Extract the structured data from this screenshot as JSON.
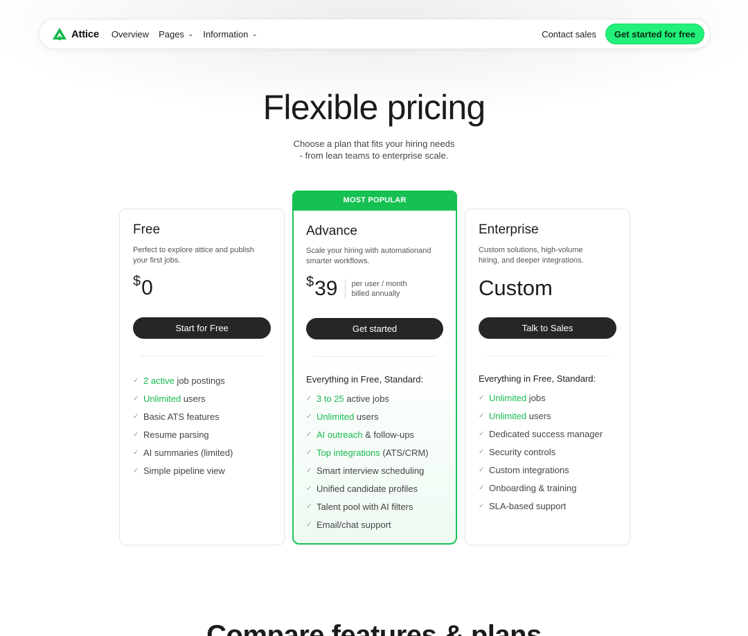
{
  "nav": {
    "brand": "Attice",
    "links": [
      {
        "label": "Overview",
        "dropdown": false
      },
      {
        "label": "Pages",
        "dropdown": true
      },
      {
        "label": "Information",
        "dropdown": true
      }
    ],
    "contact": "Contact sales",
    "cta": "Get started for free"
  },
  "hero": {
    "title": "Flexible pricing",
    "subtitle_line1": "Choose a plan that fits your hiring needs",
    "subtitle_line2": "- from lean teams to enterprise scale."
  },
  "plans": {
    "free": {
      "name": "Free",
      "desc_line1": "Perfect to explore attice and publish",
      "desc_line2": "your first jobs.",
      "currency": "$",
      "price": "0",
      "button": "Start for Free",
      "features": [
        {
          "hl": "2 active",
          "rest": " job postings"
        },
        {
          "hl": "Unlimited",
          "rest": " users"
        },
        {
          "hl": "",
          "rest": "Basic ATS features"
        },
        {
          "hl": "",
          "rest": "Resume parsing"
        },
        {
          "hl": "",
          "rest": "AI summaries (limited)"
        },
        {
          "hl": "",
          "rest": "Simple pipeline view"
        }
      ]
    },
    "advance": {
      "badge": "MOST POPULAR",
      "name": "Advance",
      "desc_line1": "Scale your hiring with automationand",
      "desc_line2": "smarter workflows.",
      "currency": "$",
      "price": "39",
      "note_line1": "per user / month",
      "note_line2": "billed annually",
      "button": "Get started",
      "everything": "Everything in Free, Standard:",
      "features": [
        {
          "hl": "3 to 25",
          "rest": " active jobs"
        },
        {
          "hl": "Unlimited",
          "rest": " users"
        },
        {
          "hl": "AI outreach",
          "rest": " & follow-ups"
        },
        {
          "hl": "Top integrations",
          "rest": " (ATS/CRM)"
        },
        {
          "hl": "",
          "rest": "Smart interview scheduling"
        },
        {
          "hl": "",
          "rest": "Unified candidate profiles"
        },
        {
          "hl": "",
          "rest": "Talent pool with AI filters"
        },
        {
          "hl": "",
          "rest": "Email/chat support"
        }
      ]
    },
    "enterprise": {
      "name": "Enterprise",
      "desc_line1": "Custom solutions, high-volume",
      "desc_line2": "hiring, and deeper integrations.",
      "price": "Custom",
      "button": "Talk to Sales",
      "everything": "Everything in Free, Standard:",
      "features": [
        {
          "hl": "Unlimited",
          "rest": " jobs"
        },
        {
          "hl": "Unlimited",
          "rest": " users"
        },
        {
          "hl": "",
          "rest": "Dedicated success manager"
        },
        {
          "hl": "",
          "rest": "Security controls"
        },
        {
          "hl": "",
          "rest": "Custom integrations"
        },
        {
          "hl": "",
          "rest": "Onboarding & training"
        },
        {
          "hl": "",
          "rest": "SLA-based support"
        }
      ]
    }
  },
  "compare_title": "Compare features & plans",
  "colors": {
    "accent": "#22f07a",
    "green": "#16c052",
    "dark_button": "#262626"
  }
}
